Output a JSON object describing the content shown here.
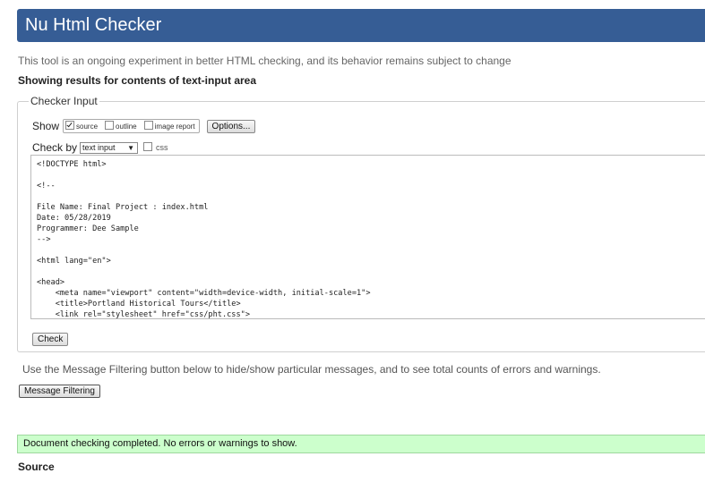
{
  "header": {
    "title": "Nu Html Checker"
  },
  "subtitle": "This tool is an ongoing experiment in better HTML checking, and its behavior remains subject to change",
  "results_heading": "Showing results for contents of text-input area",
  "checker_input": {
    "legend": "Checker Input",
    "show_label": "Show",
    "show_options": [
      {
        "label": "source",
        "checked": true
      },
      {
        "label": "outline",
        "checked": false
      },
      {
        "label": "image report",
        "checked": false
      }
    ],
    "options_button": "Options...",
    "check_by_label": "Check by",
    "check_by_selected": "text input",
    "css_label": "css",
    "css_checked": false,
    "source_code": "<!DOCTYPE html>\n\n<!--\n\nFile Name: Final Project : index.html\nDate: 05/28/2019\nProgrammer: Dee Sample\n-->\n\n<html lang=\"en\">\n\n<head>\n    <meta name=\"viewport\" content=\"width=device-width, initial-scale=1\">\n    <title>Portland Historical Tours</title>\n    <link rel=\"stylesheet\" href=\"css/pht.css\">",
    "check_button": "Check"
  },
  "filter_info": "Use the Message Filtering button below to hide/show particular messages, and to see total counts of errors and warnings.",
  "filter_button": "Message Filtering",
  "success_message": "Document checking completed. No errors or warnings to show.",
  "source_heading": "Source",
  "colors": {
    "header_bg": "#365d95",
    "success_bg": "#ccffcc"
  }
}
